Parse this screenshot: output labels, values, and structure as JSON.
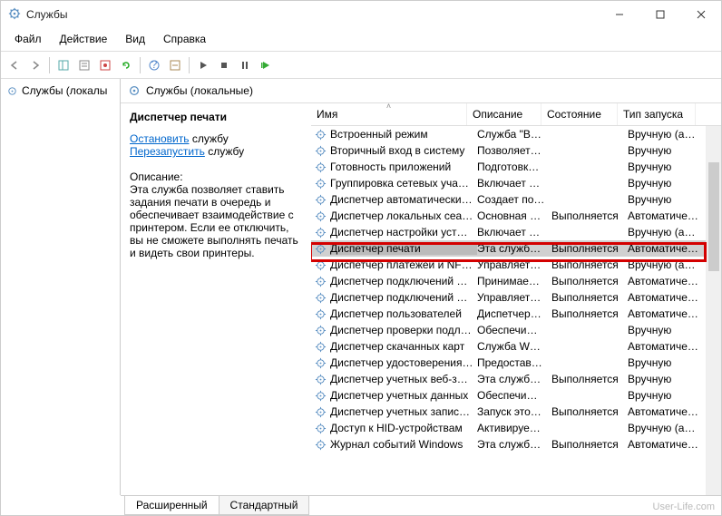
{
  "title": "Службы",
  "menu": [
    "Файл",
    "Действие",
    "Вид",
    "Справка"
  ],
  "tree_item": "Службы (локалы",
  "header": "Службы (локальные)",
  "details": {
    "selected": "Диспетчер печати",
    "stop_link": "Остановить",
    "stop_suffix": " службу",
    "restart_link": "Перезапустить",
    "restart_suffix": " службу",
    "desc_label": "Описание:",
    "desc_text": "Эта служба позволяет ставить задания печати в очередь и обеспечивает взаимодействие с принтером. Если ее отключить, вы не сможете выполнять печать и видеть свои принтеры."
  },
  "columns": [
    "Имя",
    "Описание",
    "Состояние",
    "Тип запуска"
  ],
  "rows": [
    {
      "n": "Встроенный режим",
      "d": "Служба \"В…",
      "s": "",
      "st": "Вручную (ак…"
    },
    {
      "n": "Вторичный вход в систему",
      "d": "Позволяет…",
      "s": "",
      "st": "Вручную"
    },
    {
      "n": "Готовность приложений",
      "d": "Подготовк…",
      "s": "",
      "st": "Вручную"
    },
    {
      "n": "Группировка сетевых учас…",
      "d": "Включает …",
      "s": "",
      "st": "Вручную"
    },
    {
      "n": "Диспетчер автоматически…",
      "d": "Создает по…",
      "s": "",
      "st": "Вручную"
    },
    {
      "n": "Диспетчер локальных сеа…",
      "d": "Основная …",
      "s": "Выполняется",
      "st": "Автоматиче…"
    },
    {
      "n": "Диспетчер настройки устр…",
      "d": "Включает …",
      "s": "",
      "st": "Вручную (ак…"
    },
    {
      "n": "Диспетчер печати",
      "d": "Эта служб…",
      "s": "Выполняется",
      "st": "Автоматиче…",
      "sel": true
    },
    {
      "n": "Диспетчер платежей и NF…",
      "d": "Управляет…",
      "s": "Выполняется",
      "st": "Вручную (ак…"
    },
    {
      "n": "Диспетчер подключений …",
      "d": "Принимае…",
      "s": "Выполняется",
      "st": "Автоматиче…"
    },
    {
      "n": "Диспетчер подключений …",
      "d": "Управляет…",
      "s": "Выполняется",
      "st": "Автоматиче…"
    },
    {
      "n": "Диспетчер пользователей",
      "d": "Диспетчер…",
      "s": "Выполняется",
      "st": "Автоматиче…"
    },
    {
      "n": "Диспетчер проверки подл…",
      "d": "Обеспечи…",
      "s": "",
      "st": "Вручную"
    },
    {
      "n": "Диспетчер скачанных карт",
      "d": "Служба W…",
      "s": "",
      "st": "Автоматиче…"
    },
    {
      "n": "Диспетчер удостоверения …",
      "d": "Предостав…",
      "s": "",
      "st": "Вручную"
    },
    {
      "n": "Диспетчер учетных веб-за…",
      "d": "Эта служб…",
      "s": "Выполняется",
      "st": "Вручную"
    },
    {
      "n": "Диспетчер учетных данных",
      "d": "Обеспечи…",
      "s": "",
      "st": "Вручную"
    },
    {
      "n": "Диспетчер учетных записе…",
      "d": "Запуск это…",
      "s": "Выполняется",
      "st": "Автоматиче…"
    },
    {
      "n": "Доступ к HID-устройствам",
      "d": "Активируе…",
      "s": "",
      "st": "Вручную (ак…"
    },
    {
      "n": "Журнал событий Windows",
      "d": "Эта служб…",
      "s": "Выполняется",
      "st": "Автоматиче…"
    }
  ],
  "tabs": [
    "Расширенный",
    "Стандартный"
  ],
  "watermark": "User-Life.com"
}
